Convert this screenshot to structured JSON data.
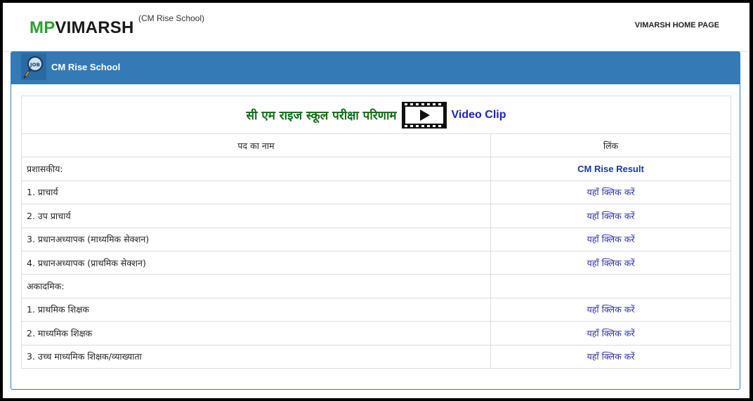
{
  "header": {
    "brand_mp": "MP",
    "brand_vimarsh": "VIMARSH",
    "brand_sup": "(CM Rise School)",
    "home_link": "VIMARSH HOME PAGE"
  },
  "panel": {
    "title": "CM Rise School"
  },
  "table": {
    "title_hindi": "सी एम राइज स्कूल परीक्षा परिणाम",
    "video_link": "Video Clip",
    "col_name": "पद का नाम",
    "col_link": "लिंक",
    "rows": [
      {
        "name": "प्रशासकीय:",
        "link": "CM Rise Result"
      },
      {
        "name": "1. प्राचार्य",
        "link": "यहाँ क्लिक करें"
      },
      {
        "name": "2. उप प्राचार्य",
        "link": "यहाँ क्लिक करें"
      },
      {
        "name": "3. प्रधानअध्यापक (माध्यमिक सेक्शन)",
        "link": "यहाँ क्लिक करें"
      },
      {
        "name": "4. प्रधानअध्यापक (प्राथमिक सेक्शन)",
        "link": "यहाँ क्लिक करें"
      },
      {
        "name": "अकादमिक:",
        "link": ""
      },
      {
        "name": "1. प्राथमिक शिक्षक",
        "link": "यहाँ क्लिक करें"
      },
      {
        "name": "2. माध्यमिक शिक्षक",
        "link": "यहाँ क्लिक करें"
      },
      {
        "name": "3. उच्च माध्यमिक शिक्षक/व्याख्याता",
        "link": "यहाँ क्लिक करें"
      }
    ]
  },
  "colors": {
    "panel_blue": "#337ab7",
    "brand_green": "#2e9e33",
    "title_green": "#0f6e12",
    "link_blue": "#2b2fa8"
  },
  "icons": [
    "job-magnifier-icon",
    "video-play-icon"
  ]
}
